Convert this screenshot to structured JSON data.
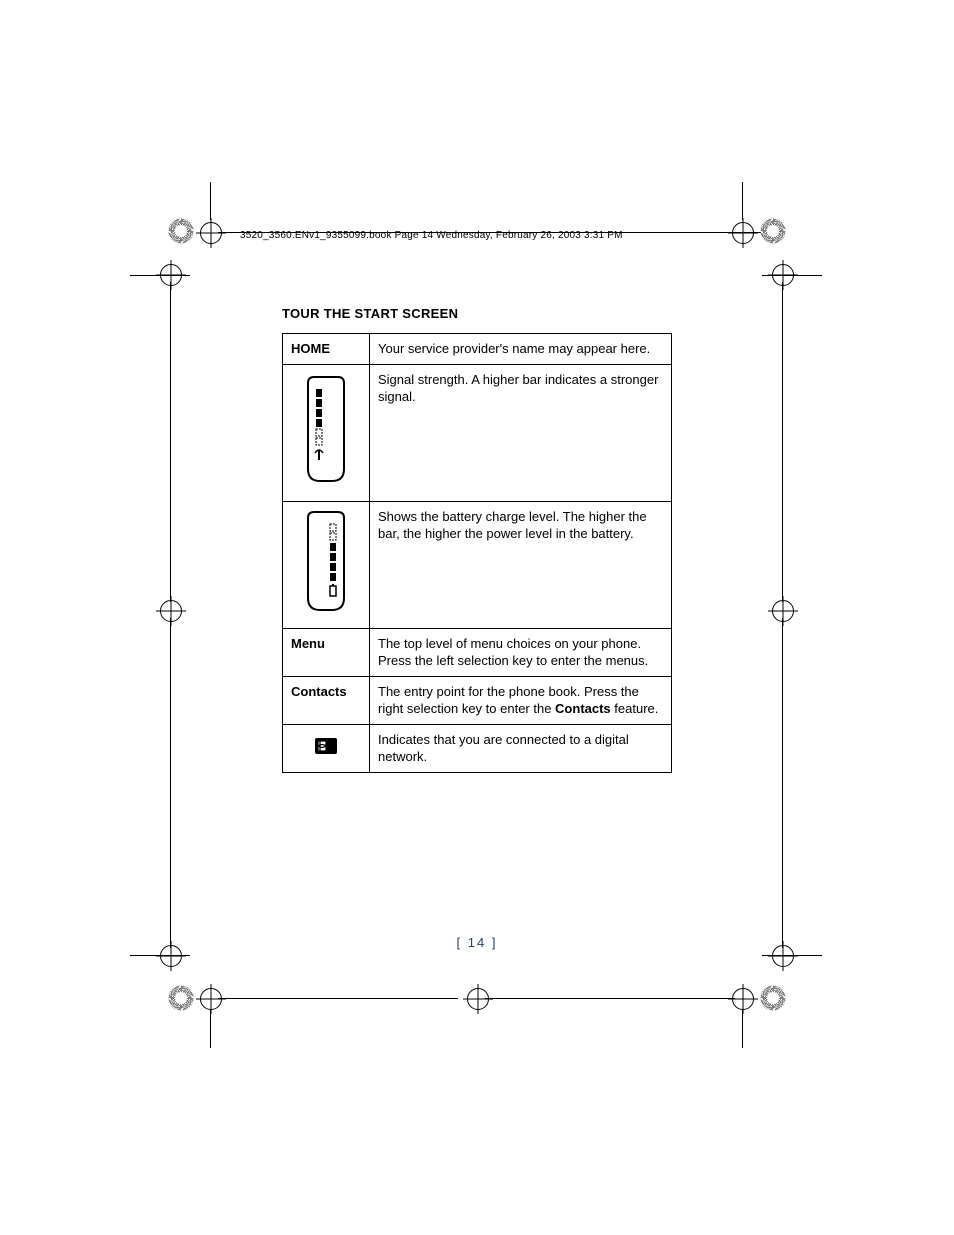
{
  "header": "3520_3560.ENv1_9355099.book  Page 14  Wednesday, February 26, 2003  3:31 PM",
  "section_title": "TOUR THE START SCREEN",
  "rows": {
    "home": {
      "label": "HOME",
      "desc": "Your service provider's name may appear here."
    },
    "signal": {
      "desc": "Signal strength. A higher bar indicates a stronger signal."
    },
    "battery": {
      "desc": "Shows the battery charge level. The higher the bar, the higher the power level in the battery."
    },
    "menu": {
      "label": "Menu",
      "desc": "The top level of menu choices on your phone. Press the left selection key to enter the menus."
    },
    "contacts": {
      "label": "Contacts",
      "desc_pre": "The entry point for the phone book. Press the right selection key to enter the ",
      "desc_bold": "Contacts",
      "desc_post": " feature."
    },
    "digital": {
      "desc": "Indicates that you are connected to a digital network."
    }
  },
  "page_number": "[ 14 ]"
}
